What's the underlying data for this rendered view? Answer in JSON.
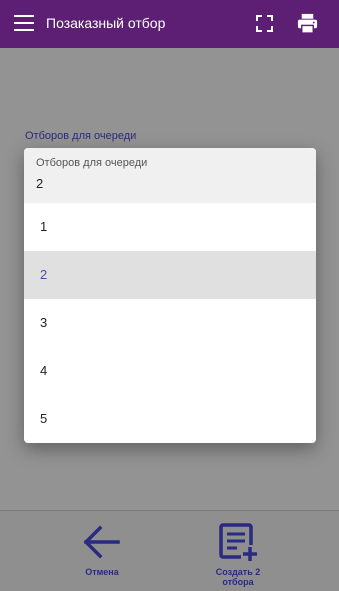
{
  "header": {
    "title": "Позаказный отбор",
    "icons": [
      "menu-icon",
      "fullscreen-icon",
      "print-icon"
    ],
    "background_color": "#5c1f73"
  },
  "form": {
    "field_label": "Отборов для очереди"
  },
  "dialog": {
    "label": "Отборов для очереди",
    "value": "2",
    "options": [
      "1",
      "2",
      "3",
      "4",
      "5"
    ],
    "selected": "2",
    "selected_color": "#4a4ab0"
  },
  "footer": {
    "cancel_label": "Отмена",
    "create_label_line1": "Создать 2",
    "create_label_line2": "отбора",
    "icon_color": "#2a2a80"
  }
}
